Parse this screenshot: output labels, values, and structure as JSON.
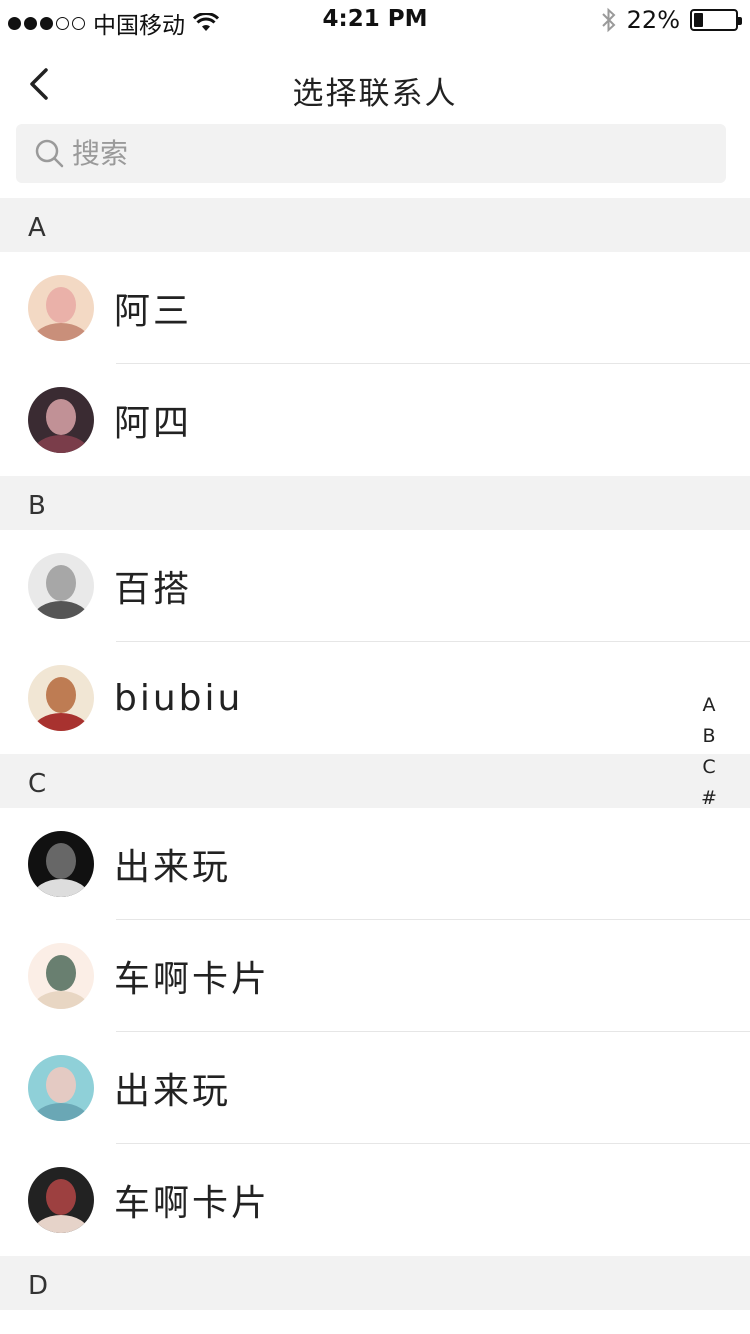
{
  "status_bar": {
    "carrier": "中国移动",
    "time": "4:21 PM",
    "battery": "22%",
    "battery_level": 0.22
  },
  "nav": {
    "title": "选择联系人"
  },
  "search": {
    "placeholder": "搜索"
  },
  "sections": [
    {
      "letter": "A",
      "contacts": [
        {
          "name": "阿三",
          "avatar_colors": [
            "#f3d9c4",
            "#e8a9a4",
            "#c98f7a"
          ]
        },
        {
          "name": "阿四",
          "avatar_colors": [
            "#3a2b32",
            "#d9a3a8",
            "#7a3d4a"
          ]
        }
      ]
    },
    {
      "letter": "B",
      "contacts": [
        {
          "name": "百搭",
          "avatar_colors": [
            "#e9e9e9",
            "#9b9b9b",
            "#555555"
          ]
        },
        {
          "name": "biubiu",
          "avatar_colors": [
            "#f1e6d4",
            "#b5693c",
            "#a8322f"
          ]
        }
      ]
    },
    {
      "letter": "C",
      "contacts": [
        {
          "name": "出来玩",
          "avatar_colors": [
            "#111111",
            "#777777",
            "#dddddd"
          ]
        },
        {
          "name": "车啊卡片",
          "avatar_colors": [
            "#fbeee6",
            "#4f6b5a",
            "#e8d6c3"
          ]
        },
        {
          "name": "出来玩",
          "avatar_colors": [
            "#8fd0d8",
            "#f3c9c0",
            "#6aa7b5"
          ]
        },
        {
          "name": "车啊卡片",
          "avatar_colors": [
            "#222222",
            "#b34545",
            "#e6d3c9"
          ]
        }
      ]
    },
    {
      "letter": "D",
      "contacts": []
    }
  ],
  "index_letters": [
    "A",
    "B",
    "C",
    "#"
  ]
}
